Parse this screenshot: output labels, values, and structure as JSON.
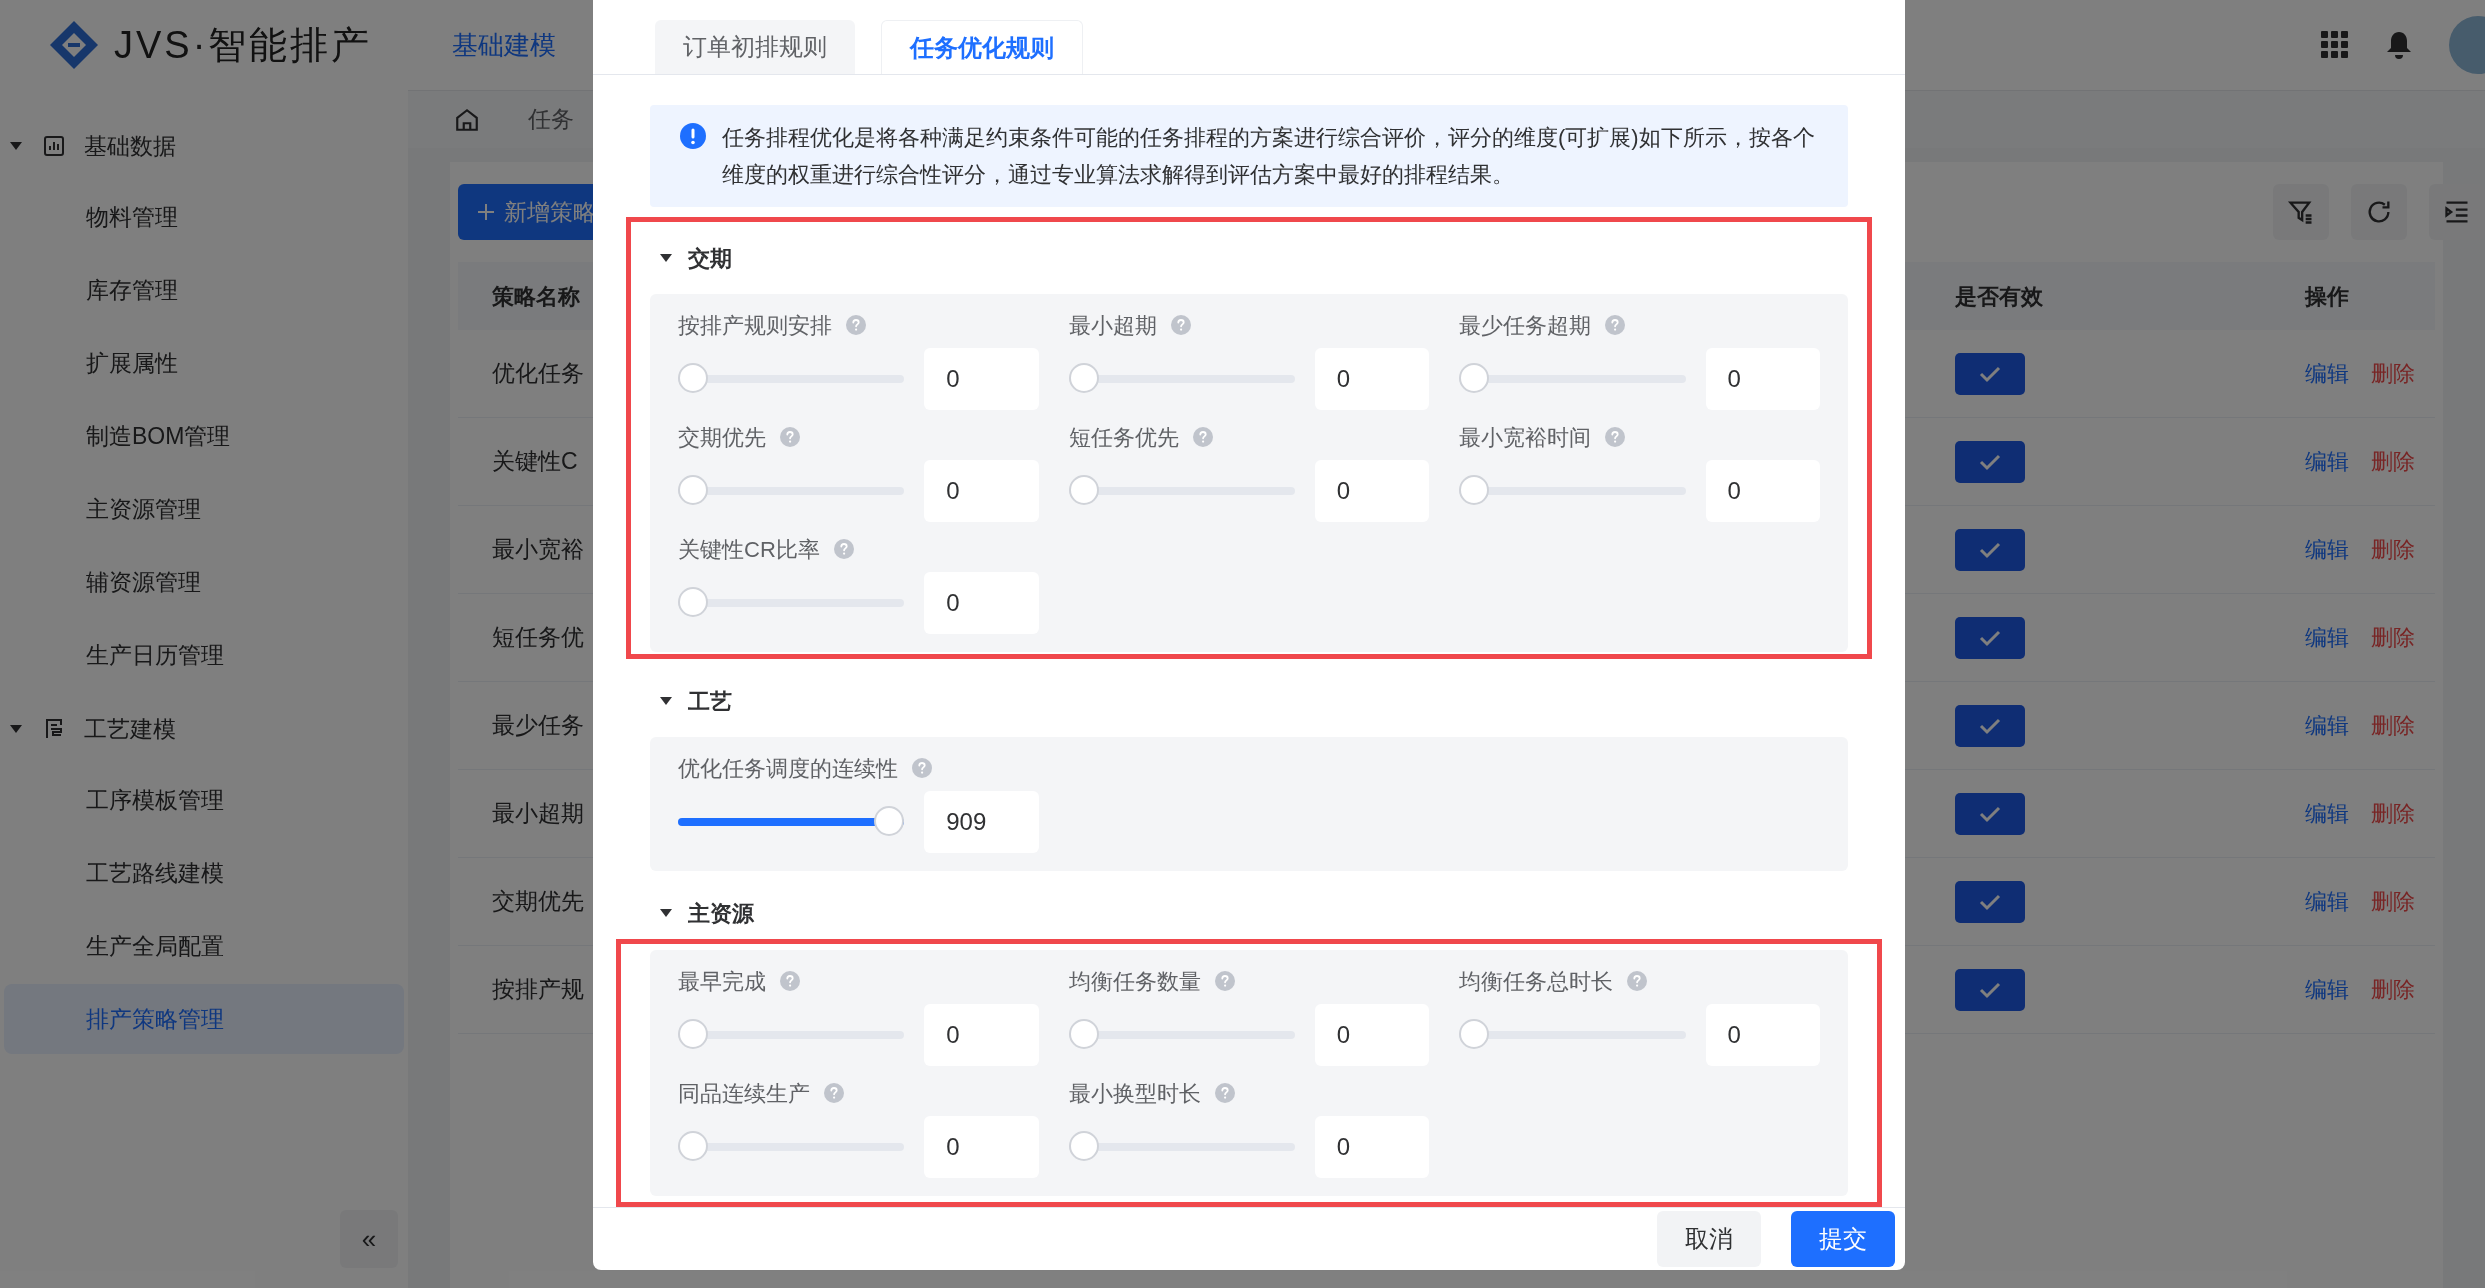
{
  "header": {
    "logo_text": "JVS·智能排产",
    "nav": [
      {
        "label": "基础建模",
        "selected": true
      }
    ]
  },
  "sidebar": {
    "groups": [
      {
        "label": "基础数据",
        "expanded": true,
        "children": [
          {
            "label": "物料管理",
            "selected": false
          },
          {
            "label": "库存管理",
            "selected": false
          },
          {
            "label": "扩展属性",
            "selected": false
          },
          {
            "label": "制造BOM管理",
            "selected": false
          },
          {
            "label": "主资源管理",
            "selected": false
          },
          {
            "label": "辅资源管理",
            "selected": false
          },
          {
            "label": "生产日历管理",
            "selected": false
          }
        ]
      },
      {
        "label": "工艺建模",
        "expanded": true,
        "children": [
          {
            "label": "工序模板管理",
            "selected": false
          },
          {
            "label": "工艺路线建模",
            "selected": false
          },
          {
            "label": "生产全局配置",
            "selected": false
          },
          {
            "label": "排产策略管理",
            "selected": true
          }
        ]
      }
    ],
    "collapse": "«"
  },
  "breadcrumb": {
    "tab": "任务"
  },
  "add_button": "新增策略",
  "table": {
    "columns": [
      "策略名称",
      "是否有效",
      "操作"
    ],
    "rows": [
      {
        "name": "优化任务",
        "valid": true,
        "edit": "编辑",
        "delete": "删除"
      },
      {
        "name": "关键性C",
        "valid": true,
        "edit": "编辑",
        "delete": "删除"
      },
      {
        "name": "最小宽裕",
        "valid": true,
        "edit": "编辑",
        "delete": "删除"
      },
      {
        "name": "短任务优",
        "valid": true,
        "edit": "编辑",
        "delete": "删除"
      },
      {
        "name": "最少任务",
        "valid": true,
        "edit": "编辑",
        "delete": "删除"
      },
      {
        "name": "最小超期",
        "valid": true,
        "edit": "编辑",
        "delete": "删除"
      },
      {
        "name": "交期优先",
        "valid": true,
        "edit": "编辑",
        "delete": "删除"
      },
      {
        "name": "按排产规",
        "valid": true,
        "edit": "编辑",
        "delete": "删除"
      }
    ]
  },
  "modal": {
    "tabs": [
      {
        "label": "订单初排规则",
        "selected": false
      },
      {
        "label": "任务优化规则",
        "selected": true
      }
    ],
    "info": "任务排程优化是将各种满足约束条件可能的任务排程的方案进行综合评价，评分的维度(可扩展)如下所示，按各个维度的权重进行综合性评分，通过专业算法求解得到评估方案中最好的排程结果。",
    "sections": [
      {
        "title": "交期",
        "expanded": true,
        "kind": "framed",
        "items": [
          {
            "label": "按排产规则安排",
            "level": 0,
            "value": "0"
          },
          {
            "label": "最小超期",
            "level": 0,
            "value": "0"
          },
          {
            "label": "最少任务超期",
            "level": 0,
            "value": "0"
          },
          {
            "label": "交期优先",
            "level": 0,
            "value": "0"
          },
          {
            "label": "短任务优先",
            "level": 0,
            "value": "0"
          },
          {
            "label": "最小宽裕时间",
            "level": 0,
            "value": "0"
          },
          {
            "label": "关键性CR比率",
            "level": 0,
            "value": "0"
          }
        ]
      },
      {
        "title": "工艺",
        "expanded": true,
        "kind": "plain",
        "items": [
          {
            "label": "优化任务调度的连续性",
            "level": 1,
            "value": "909"
          }
        ]
      },
      {
        "title": "主资源",
        "expanded": true,
        "kind": "framedpanel",
        "items": [
          {
            "label": "最早完成",
            "level": 0,
            "value": "0"
          },
          {
            "label": "均衡任务数量",
            "level": 0,
            "value": "0"
          },
          {
            "label": "均衡任务总时长",
            "level": 0,
            "value": "0"
          },
          {
            "label": "同品连续生产",
            "level": 0,
            "value": "0"
          },
          {
            "label": "最小换型时长",
            "level": 0,
            "value": "0"
          }
        ]
      }
    ],
    "buttons": {
      "cancel": "取消",
      "submit": "提交"
    }
  }
}
